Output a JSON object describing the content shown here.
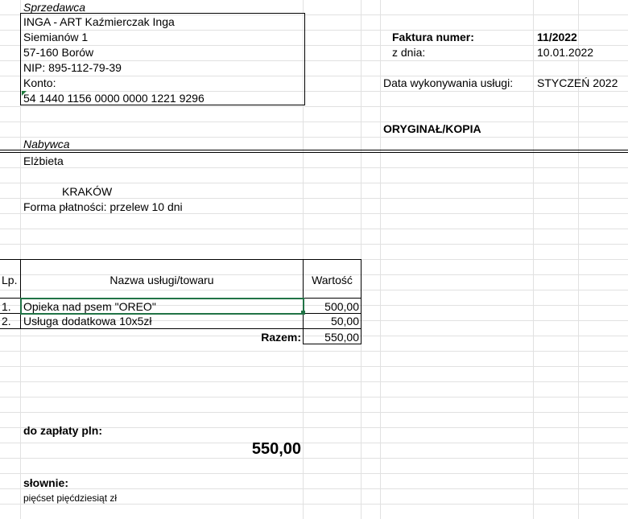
{
  "seller": {
    "label": "Sprzedawca",
    "name": "INGA - ART Kaźmierczak Inga",
    "street": "Siemianów 1",
    "city": "57-160 Borów",
    "nip": "NIP: 895-112-79-39",
    "account_label": "Konto:",
    "account": "54 1440 1156 0000 0000 1221 9296"
  },
  "invoice": {
    "number_label": "Faktura numer:",
    "number": "11/2022",
    "date_label": "z dnia:",
    "date": "10.01.2022",
    "service_date_label": "Data wykonywania usługi:",
    "service_date": "STYCZEŃ 2022",
    "copy_label": "ORYGINAŁ/KOPIA"
  },
  "buyer": {
    "label": "Nabywca",
    "name": "Elżbieta",
    "city": "KRAKÓW",
    "payment": "Forma płatności: przelew 10 dni"
  },
  "table": {
    "headers": {
      "lp": "Lp.",
      "name": "Nazwa usługi/towaru",
      "value": "Wartość"
    },
    "rows": [
      {
        "lp": "1.",
        "name": "Opieka nad psem \"OREO\"",
        "value": "500,00"
      },
      {
        "lp": "2.",
        "name": "Usługa dodatkowa 10x5zł",
        "value": "50,00"
      }
    ],
    "total_label": "Razem:",
    "total_value": "550,00"
  },
  "payment": {
    "due_label": "do zapłaty pln:",
    "due_value": "550,00",
    "words_label": "słownie:",
    "words_value": "pięćset pięćdziesiąt zł"
  }
}
